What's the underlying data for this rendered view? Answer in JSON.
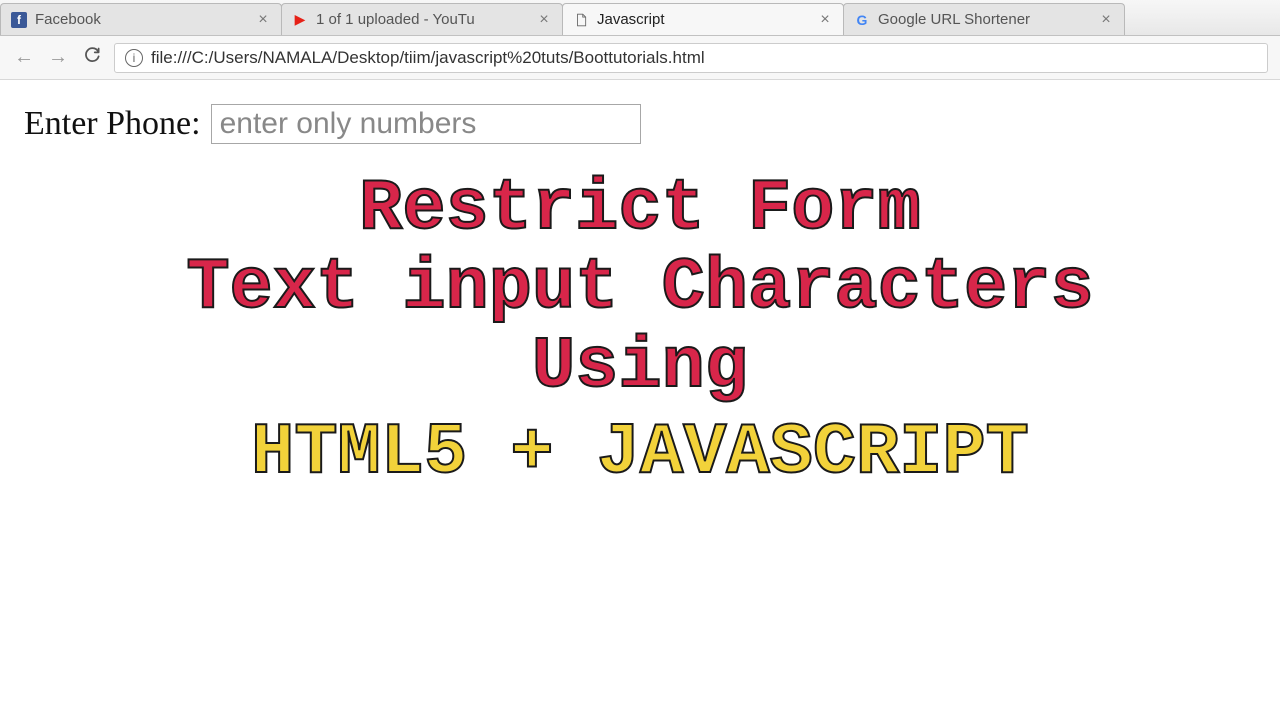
{
  "tabs": [
    {
      "label": "Facebook"
    },
    {
      "label": "1 of 1 uploaded - YouTu"
    },
    {
      "label": "Javascript"
    },
    {
      "label": "Google URL Shortener"
    }
  ],
  "url": "file:///C:/Users/NAMALA/Desktop/tiim/javascript%20tuts/Boottutorials.html",
  "form": {
    "label": "Enter Phone:",
    "placeholder": "enter only numbers"
  },
  "overlay": {
    "line1": "Restrict Form",
    "line2": "Text input Characters",
    "line3": "Using",
    "line4": "HTML5 + JAVASCRIPT"
  }
}
